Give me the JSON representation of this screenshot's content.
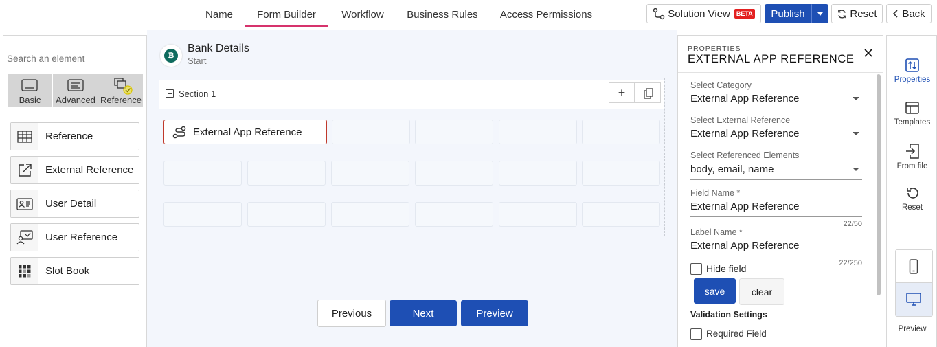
{
  "topbar": {
    "tabs": [
      "Name",
      "Form Builder",
      "Workflow",
      "Business Rules",
      "Access Permissions"
    ],
    "active_tab": "Form Builder",
    "solution_view_label": "Solution View",
    "beta_badge": "BETA",
    "publish_label": "Publish",
    "reset_label": "Reset",
    "back_label": "Back"
  },
  "left": {
    "search_placeholder": "Search an element",
    "categories": [
      "Basic",
      "Advanced",
      "Reference"
    ],
    "active_category": "Reference",
    "elements": [
      "Reference",
      "External Reference",
      "User Detail",
      "User Reference",
      "Slot Book"
    ]
  },
  "canvas": {
    "form_title": "Bank Details",
    "form_subtitle": "Start",
    "section_label": "Section 1",
    "placed_element_label": "External App Reference",
    "buttons": {
      "previous": "Previous",
      "next": "Next",
      "preview": "Preview"
    }
  },
  "properties": {
    "header_small": "PROPERTIES",
    "header_title": "EXTERNAL APP REFERENCE",
    "select_category_label": "Select Category",
    "select_category_value": "External App Reference",
    "select_external_label": "Select External Reference",
    "select_external_value": "External App Reference",
    "select_referenced_label": "Select Referenced Elements",
    "select_referenced_value": "body, email, name",
    "field_name_label": "Field Name *",
    "field_name_value": "External App Reference",
    "field_name_counter": "22/50",
    "label_name_label": "Label Name *",
    "label_name_value": "External App Reference",
    "label_name_counter": "22/250",
    "hide_field_label": "Hide field",
    "save_label": "save",
    "clear_label": "clear",
    "validation_heading": "Validation Settings",
    "required_field_label": "Required Field"
  },
  "rail": {
    "items": [
      "Properties",
      "Templates",
      "From file",
      "Reset"
    ],
    "preview_label": "Preview"
  },
  "colors": {
    "accent_tab": "#d6336c",
    "primary": "#1e4fb4",
    "beta": "#e32020",
    "selected_element_border": "#c0392b"
  }
}
